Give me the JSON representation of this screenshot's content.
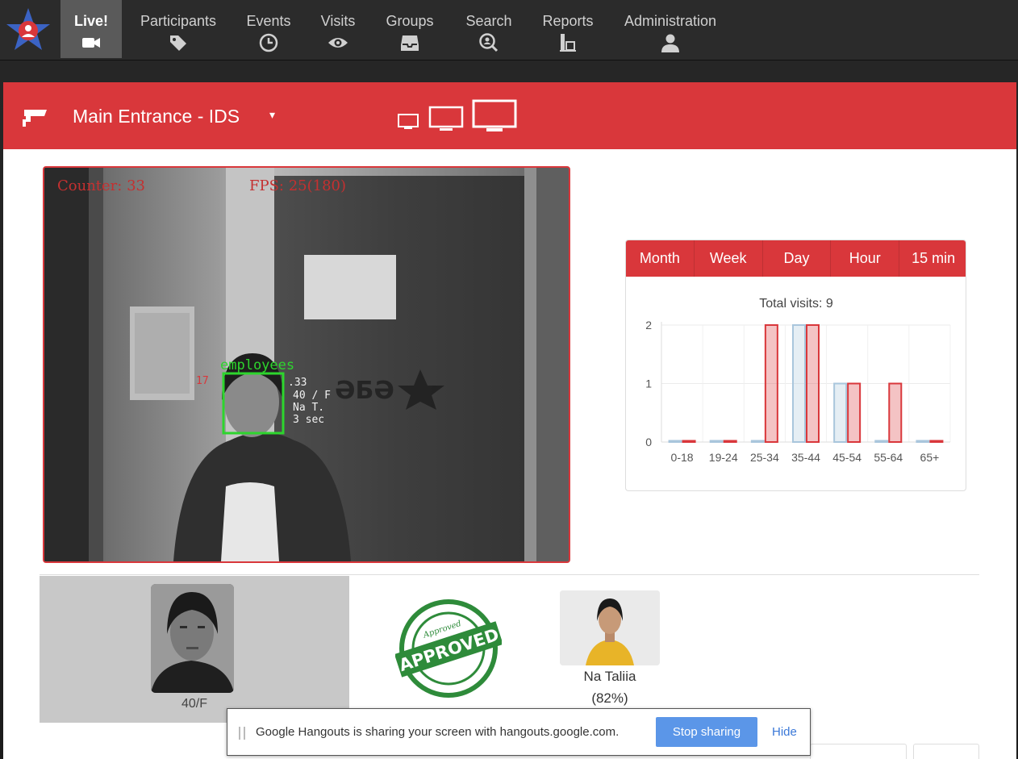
{
  "nav": {
    "items": [
      {
        "label": "Live!",
        "icon": "video-camera-icon",
        "active": true
      },
      {
        "label": "Participants",
        "icon": "tags-icon"
      },
      {
        "label": "Events",
        "icon": "clock-icon"
      },
      {
        "label": "Visits",
        "icon": "eye-icon"
      },
      {
        "label": "Groups",
        "icon": "inbox-icon"
      },
      {
        "label": "Search",
        "icon": "search-face-icon"
      },
      {
        "label": "Reports",
        "icon": "report-icon"
      },
      {
        "label": "Administration",
        "icon": "user-icon"
      }
    ]
  },
  "camera": {
    "title": "Main Entrance - IDS",
    "caret": "▾"
  },
  "video": {
    "counter_text": "Counter: 33",
    "fps_text": "FPS: 25(180)",
    "group_label": "employees",
    "id_text": "17",
    "track_lines": [
      ".33",
      "40 / F",
      "Na T.",
      "3 sec"
    ]
  },
  "chart_tabs": [
    "Month",
    "Week",
    "Day",
    "Hour",
    "15 min"
  ],
  "chart_data": {
    "type": "bar",
    "title": "Total visits: 9",
    "categories": [
      "0-18",
      "19-24",
      "25-34",
      "35-44",
      "45-54",
      "55-64",
      "65+"
    ],
    "series": [
      {
        "values": [
          0,
          0,
          0,
          2,
          1,
          0,
          0
        ],
        "color": "#a9c6dc"
      },
      {
        "values": [
          0,
          0,
          2,
          2,
          1,
          1,
          0
        ],
        "color": "#d9373b"
      }
    ],
    "ylim": [
      0,
      2
    ],
    "yticks": [
      0,
      1,
      2
    ],
    "grid": true
  },
  "detection": {
    "label": "40/F",
    "stamp_text": "APPROVED",
    "stamp_small_text": "Approved"
  },
  "match": {
    "name": "Na Taliia",
    "score": "(82%)"
  },
  "share_bar": {
    "message": "Google Hangouts is sharing your screen with hangouts.google.com.",
    "stop_label": "Stop sharing",
    "hide_label": "Hide"
  },
  "colors": {
    "accent": "#d9373b",
    "nav_bg": "#2b2b2b",
    "nav_active": "#5a5a5a",
    "detect_green": "#2dd52d",
    "stamp_green": "#2e8b3a",
    "share_button": "#5b96e8"
  }
}
